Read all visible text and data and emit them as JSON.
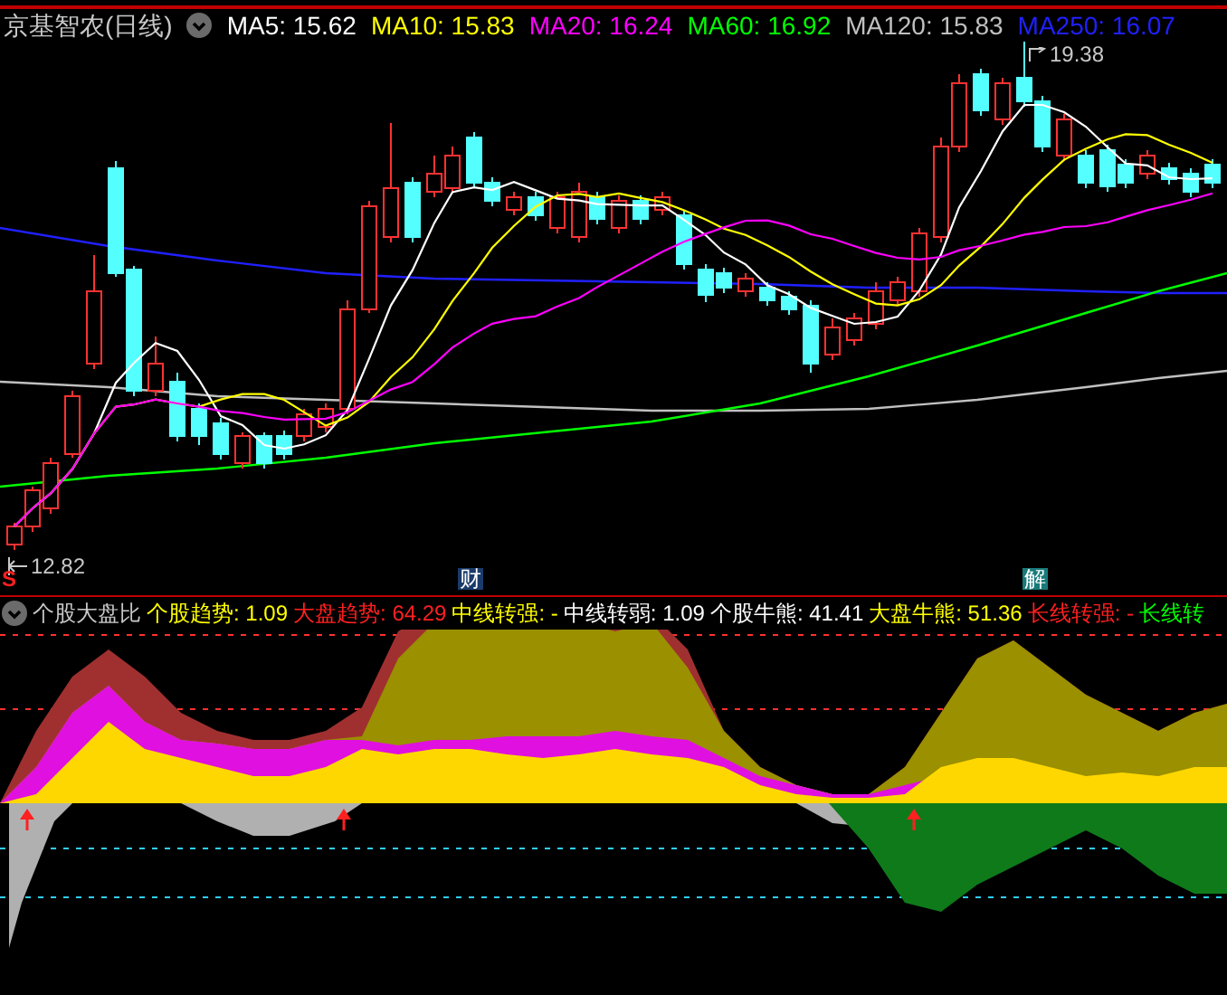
{
  "title": "京基智农(日线)",
  "ma_legend": [
    {
      "label": "MA5: 15.62",
      "color": "#ffffff"
    },
    {
      "label": "MA10: 15.83",
      "color": "#ffff00"
    },
    {
      "label": "MA20: 16.24",
      "color": "#ff00ff"
    },
    {
      "label": "MA60: 16.92",
      "color": "#00ff00"
    },
    {
      "label": "MA120: 15.83",
      "color": "#c0c0c0"
    },
    {
      "label": "MA250: 16.07",
      "color": "#2020ff"
    }
  ],
  "price_chart": {
    "high_label": "19.38",
    "low_label": "12.82"
  },
  "markers": [
    {
      "text": "S",
      "kind": "signal"
    },
    {
      "text": "财",
      "kind": "event"
    },
    {
      "text": "解",
      "kind": "unlock"
    }
  ],
  "indicator": {
    "title": "个股大盘比",
    "legend": [
      {
        "label": "个股趋势: 1.09",
        "color": "#ffff00"
      },
      {
        "label": "大盘趋势: 64.29",
        "color": "#ff2020"
      },
      {
        "label": "中线转强: -",
        "color": "#ffff00"
      },
      {
        "label": "中线转弱: 1.09",
        "color": "#ffffff"
      },
      {
        "label": "个股牛熊: 41.41",
        "color": "#ffffff"
      },
      {
        "label": "大盘牛熊: 51.36",
        "color": "#ffff00"
      },
      {
        "label": "长线转强: -",
        "color": "#ff2020"
      },
      {
        "label": "长线转",
        "color": "#00ff00"
      }
    ]
  }
}
